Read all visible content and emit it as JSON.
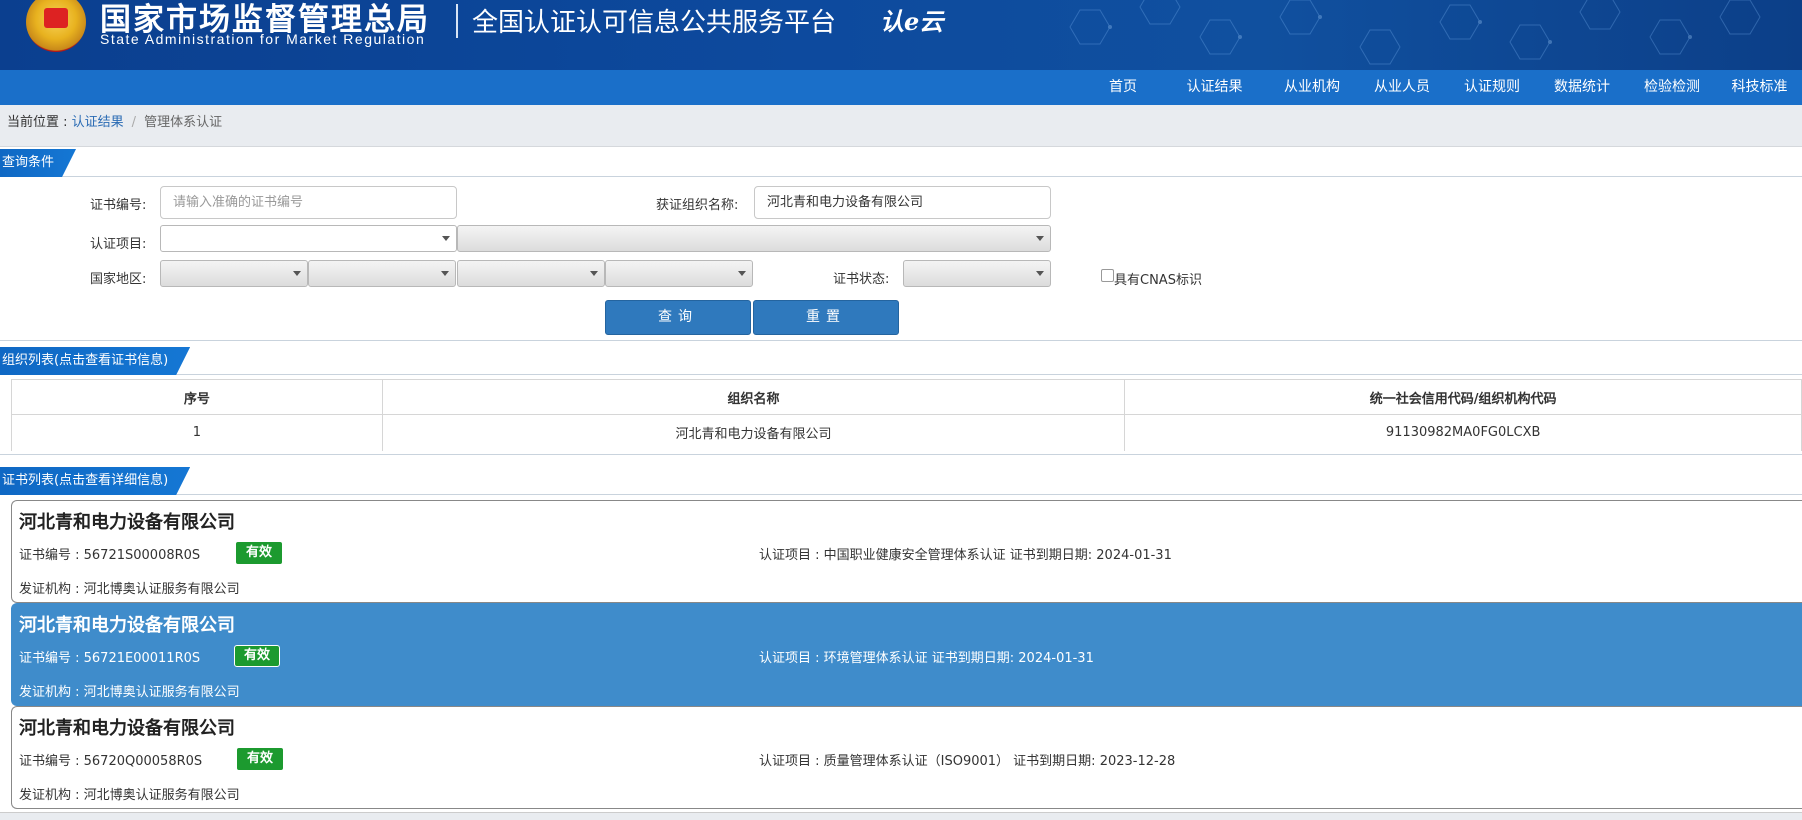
{
  "header": {
    "org_name_cn": "国家市场监督管理总局",
    "org_name_en": "State Administration  for  Market Regulation",
    "platform_title": "全国认证认可信息公共服务平台",
    "logo_text": "认e云"
  },
  "nav": {
    "items": [
      "首页",
      "认证结果",
      "从业机构",
      "从业人员",
      "认证规则",
      "数据统计",
      "检验检测",
      "科技标准"
    ]
  },
  "breadcrumb": {
    "label": "当前位置 : ",
    "link": "认证结果",
    "separator": "/",
    "current": "管理体系认证"
  },
  "query": {
    "section_title": "查询条件",
    "cert_no_label": "证书编号:",
    "cert_no_placeholder": "请输入准确的证书编号",
    "org_label": "获证组织名称:",
    "org_value": "河北青和电力设备有限公司",
    "project_label": "认证项目:",
    "region_label": "国家地区:",
    "status_label": "证书状态:",
    "cnas_label": "具有CNAS标识",
    "search_button": "查询",
    "reset_button": "重置"
  },
  "org_list": {
    "section_title": "组织列表(点击查看证书信息)",
    "columns": [
      "序号",
      "组织名称",
      "统一社会信用代码/组织机构代码"
    ],
    "rows": [
      {
        "index": "1",
        "name": "河北青和电力设备有限公司",
        "code": "91130982MA0FG0LCXB"
      }
    ]
  },
  "cert_list": {
    "section_title": "证书列表(点击查看详细信息)",
    "items": [
      {
        "company": "河北青和电力设备有限公司",
        "cert_no": "证书编号 : 56721S00008R0S",
        "status": "有效",
        "project": "认证项目 : 中国职业健康安全管理体系认证    证书到期日期: 2024-01-31",
        "issuer": "发证机构 : 河北博奥认证服务有限公司"
      },
      {
        "company": "河北青和电力设备有限公司",
        "cert_no": "证书编号 : 56721E00011R0S",
        "status": "有效",
        "project": "认证项目 : 环境管理体系认证    证书到期日期: 2024-01-31",
        "issuer": "发证机构 : 河北博奥认证服务有限公司"
      },
      {
        "company": "河北青和电力设备有限公司",
        "cert_no": "证书编号 : 56720Q00058R0S",
        "status": "有效",
        "project": "认证项目 : 质量管理体系认证（ISO9001）    证书到期日期: 2023-12-28",
        "issuer": "发证机构 : 河北博奥认证服务有限公司"
      }
    ]
  },
  "colors": {
    "banner": "#0d4a9e",
    "nav": "#1a6fc9",
    "accent": "#1577d4",
    "button": "#2f79bd",
    "valid_badge": "#1c9a2f",
    "selected_card": "#3f8ccb"
  }
}
